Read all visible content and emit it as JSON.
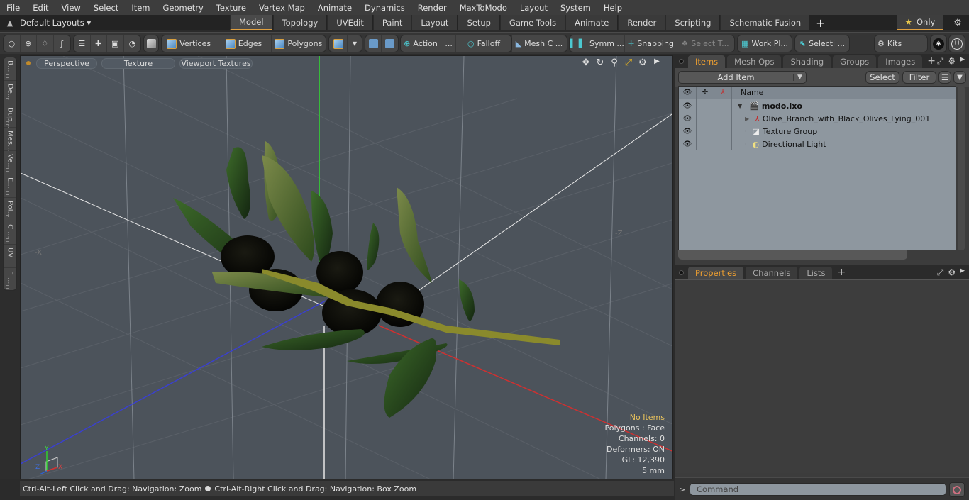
{
  "menu": [
    "File",
    "Edit",
    "View",
    "Select",
    "Item",
    "Geometry",
    "Texture",
    "Vertex Map",
    "Animate",
    "Dynamics",
    "Render",
    "MaxToModo",
    "Layout",
    "System",
    "Help"
  ],
  "layout_bar": {
    "layouts_label": "Default Layouts ▾",
    "tabs": [
      "Model",
      "Topology",
      "UVEdit",
      "Paint",
      "Layout",
      "Setup",
      "Game Tools",
      "Animate",
      "Render",
      "Scripting",
      "Schematic Fusion"
    ],
    "active_tab": "Model",
    "add_tab": "+",
    "only_label": "Only",
    "star_icon": "★",
    "gear_icon": "⚙"
  },
  "toolbar": {
    "vertices": "Vertices",
    "edges": "Edges",
    "polygons": "Polygons",
    "action": "Action",
    "action_more": "...",
    "falloff": "Falloff",
    "mesh_c": "Mesh C ...",
    "symm": "Symm ...",
    "snapping": "Snapping",
    "select_t": "Select T...",
    "work_pl": "Work Pl...",
    "selecti": "Selecti ...",
    "kits": "Kits"
  },
  "left_strip": [
    "B...",
    "De...",
    "Dup...",
    "Mes...",
    "Ve...",
    "E...",
    "Pol...",
    "C ...",
    "UV",
    "F ..."
  ],
  "viewport": {
    "view_mode": "Perspective",
    "shading": "Texture",
    "textures": "Viewport Textures",
    "info": {
      "selection": "No Items",
      "polygons": "Polygons : Face",
      "channels": "Channels: 0",
      "deformers": "Deformers: ON",
      "gl": "GL: 12,390",
      "unit": "5 mm"
    },
    "axis_labels": {
      "x": "X",
      "y": "Y",
      "z": "Z",
      "neg_x": "-X",
      "neg_z": "-Z"
    }
  },
  "status_bar": {
    "hint_left": "Ctrl-Alt-Left Click and Drag: Navigation: Zoom",
    "hint_right": "Ctrl-Alt-Right Click and Drag: Navigation: Box Zoom"
  },
  "items_panel": {
    "tabs": [
      "Items",
      "Mesh Ops",
      "Shading",
      "Groups",
      "Images"
    ],
    "active_tab": "Items",
    "add_item": "Add Item",
    "select": "Select",
    "filter": "Filter",
    "name_header": "Name",
    "tree": [
      {
        "label": "modo.lxo",
        "type": "scene",
        "depth": 0,
        "expanded": true
      },
      {
        "label": "Olive_Branch_with_Black_Olives_Lying_001",
        "type": "mesh",
        "depth": 1,
        "expanded": false
      },
      {
        "label": "Texture Group",
        "type": "texture-group",
        "depth": 1
      },
      {
        "label": "Directional Light",
        "type": "light",
        "depth": 1
      }
    ]
  },
  "properties_panel": {
    "tabs": [
      "Properties",
      "Channels",
      "Lists"
    ],
    "active_tab": "Properties"
  },
  "command": {
    "prompt": ">",
    "placeholder": "Command"
  },
  "colors": {
    "accent": "#f0a030",
    "viewport_bg": "#4c535b",
    "axis_x": "#d03030",
    "axis_y": "#30d030",
    "axis_z": "#3040d0"
  }
}
